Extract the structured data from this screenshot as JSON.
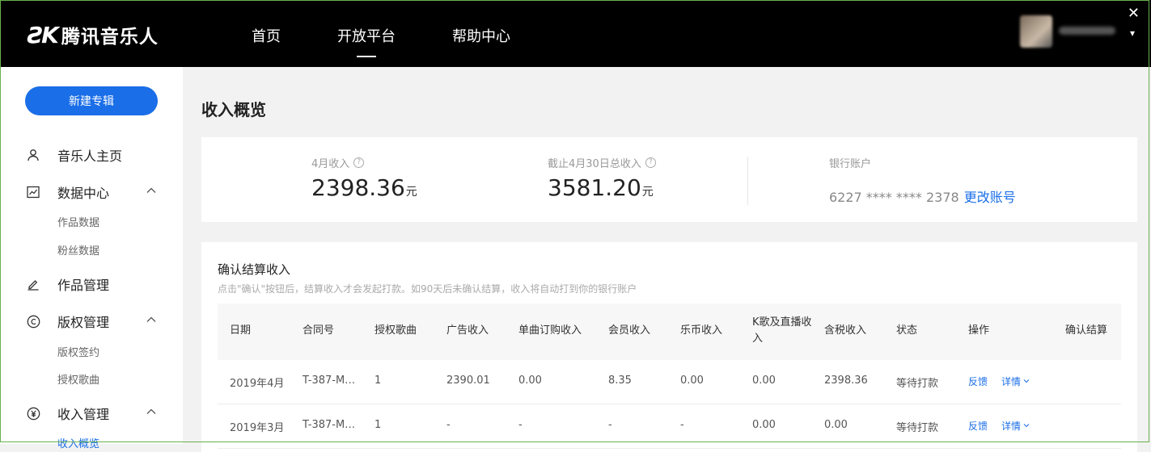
{
  "header": {
    "logo_mark": "ƧK",
    "logo_text": "腾讯音乐人",
    "nav": [
      "首页",
      "开放平台",
      "帮助中心"
    ],
    "active_nav": "开放平台",
    "close_glyph": "✕",
    "user_chevron": "▾"
  },
  "sidebar": {
    "new_album": "新建专辑",
    "items": [
      {
        "label": "音乐人主页",
        "icon": "user-icon"
      },
      {
        "label": "数据中心",
        "icon": "chart-icon",
        "expanded": true,
        "subs": [
          "作品数据",
          "粉丝数据"
        ]
      },
      {
        "label": "作品管理",
        "icon": "pencil-icon"
      },
      {
        "label": "版权管理",
        "icon": "copyright-icon",
        "expanded": true,
        "subs": [
          "版权签约",
          "授权歌曲"
        ]
      },
      {
        "label": "收入管理",
        "icon": "yen-icon",
        "expanded": true,
        "subs": [
          "收入概览"
        ]
      }
    ]
  },
  "main": {
    "title": "收入概览",
    "stats": [
      {
        "label": "4月收入",
        "value": "2398.36",
        "unit": "元"
      },
      {
        "label": "截止4月30日总收入",
        "value": "3581.20",
        "unit": "元"
      }
    ],
    "bank": {
      "label": "银行账户",
      "number": "6227 **** **** 2378",
      "link": "更改账号"
    },
    "section": {
      "title": "确认结算收入",
      "desc": "点击\"确认\"按钮后，结算收入才会发起打款。如90天后未确认结算，收入将自动打到你的银行账户"
    },
    "table": {
      "headers": [
        "日期",
        "合同号",
        "授权歌曲",
        "广告收入",
        "单曲订购收入",
        "会员收入",
        "乐币收入",
        "K歌及直播收入",
        "含税收入",
        "状态",
        "操作",
        "确认结算"
      ],
      "rows": [
        [
          "2019年4月",
          "T-387-M…",
          "1",
          "2390.01",
          "0.00",
          "8.35",
          "0.00",
          "0.00",
          "2398.36",
          "等待打款",
          "反馈",
          "详情"
        ],
        [
          "2019年3月",
          "T-387-M…",
          "1",
          "-",
          "-",
          "-",
          "-",
          "0.00",
          "0.00",
          "等待打款",
          "反馈",
          "详情"
        ]
      ]
    },
    "colors": {
      "accent": "#1a6ee8",
      "header_bg": "#000000"
    }
  }
}
